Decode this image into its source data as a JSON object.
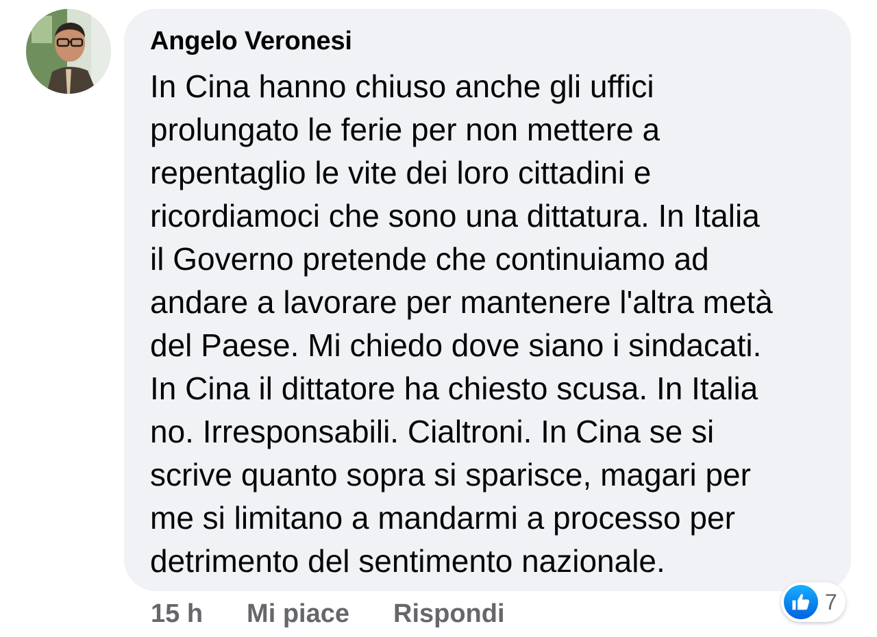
{
  "comment": {
    "author": "Angelo Veronesi",
    "text_lines": [
      "In Cina hanno chiuso anche gli uffici",
      "prolungato le ferie per non mettere a",
      "repentaglio le vite dei loro cittadini e",
      "ricordiamoci che sono una dittatura. In Italia",
      "il Governo pretende che continuiamo ad",
      "andare a lavorare per mantenere l'altra metà",
      "del Paese. Mi chiedo dove siano i sindacati.",
      "In Cina il dittatore ha chiesto scusa. In Italia",
      "no. Irresponsabili. Cialtroni. In Cina se si",
      "scrive quanto sopra si sparisce, magari per",
      "me si limitano a mandarmi a processo per",
      "detrimento del sentimento nazionale."
    ]
  },
  "actions": {
    "timestamp": "15 h",
    "like_label": "Mi piace",
    "reply_label": "Rispondi"
  },
  "reactions": {
    "icon": "like-thumb-icon",
    "count": "7"
  },
  "colors": {
    "bubble_bg": "#f0f2f5",
    "action_text": "#65676b",
    "like_blue": "#1877f2"
  }
}
